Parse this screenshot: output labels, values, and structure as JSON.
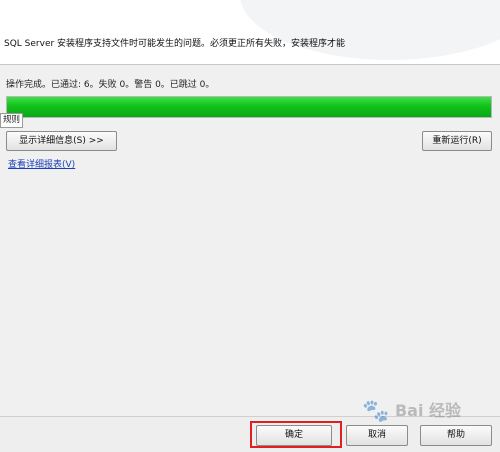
{
  "header": {
    "description": "SQL Server 安装程序支持文件时可能发生的问题。必须更正所有失败，安装程序才能"
  },
  "status": {
    "summary": "操作完成。已通过: 6。失败 0。警告 0。已跳过 0。"
  },
  "progress": {
    "percent": 100,
    "color": "#12c21c"
  },
  "tooltip": {
    "text": "规则"
  },
  "buttons": {
    "show_details": "显示详细信息(S) >>",
    "rerun": "重新运行(R)",
    "ok": "确定",
    "cancel": "取消",
    "help": "帮助"
  },
  "links": {
    "view_report": "查看详细报表(V)"
  },
  "highlight": {
    "color": "#e02020"
  },
  "watermark": {
    "text": "Bai 经验",
    "icon": "paw-icon"
  }
}
